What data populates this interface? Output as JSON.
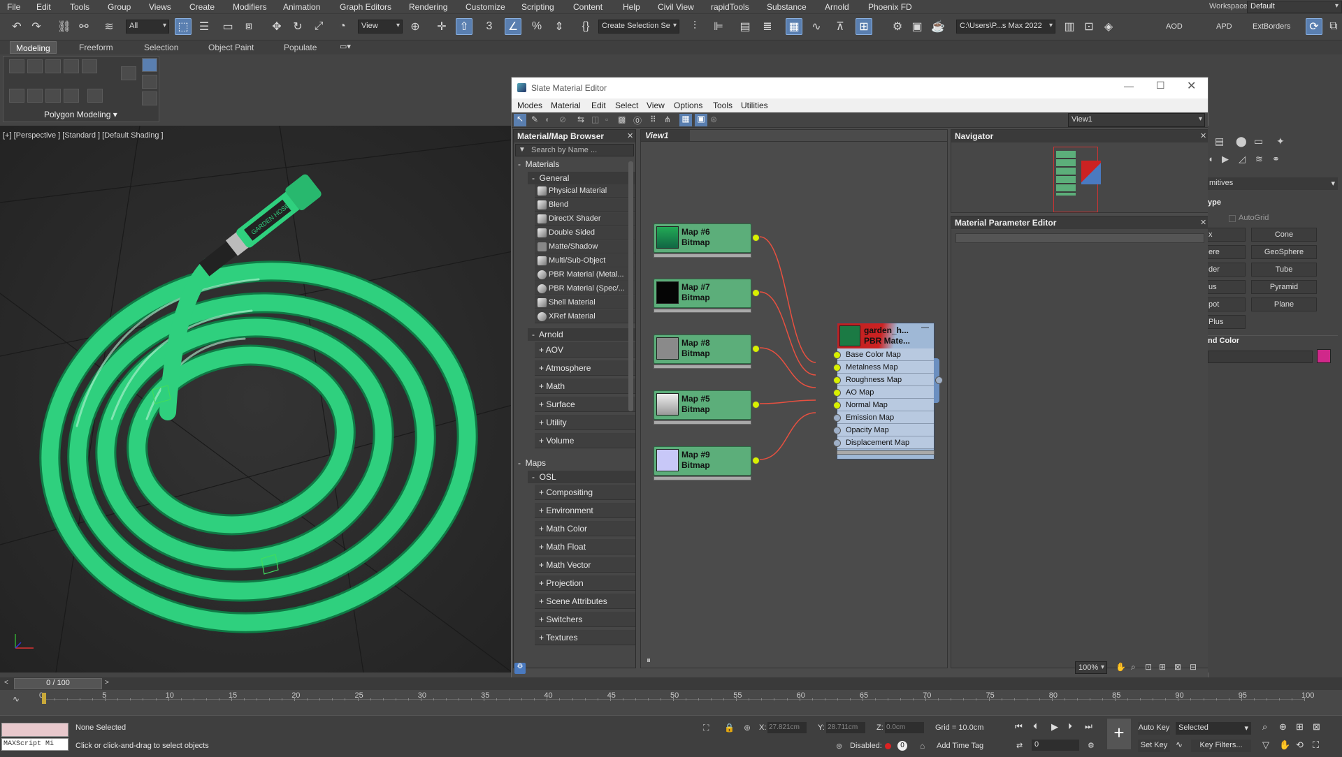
{
  "menubar": {
    "items": [
      "File",
      "Edit",
      "Tools",
      "Group",
      "Views",
      "Create",
      "Modifiers",
      "Animation",
      "Graph Editors",
      "Rendering",
      "Customize",
      "Scripting",
      "Content",
      "Help",
      "Civil View",
      "rapidTools",
      "Substance",
      "Arnold",
      "Phoenix FD"
    ],
    "workspaces_label": "Workspaces:",
    "workspace_value": "Default"
  },
  "toolbar": {
    "selection_filter": "All",
    "ref_coord": "View",
    "named_selection": "Create Selection Se",
    "project_path": "C:\\Users\\P...s Max 2022",
    "plugin_labels": [
      "AOD",
      "APD",
      "ExtBorders"
    ]
  },
  "ribbon": {
    "tabs": [
      "Modeling",
      "Freeform",
      "Selection",
      "Object Paint",
      "Populate"
    ],
    "active_tab": "Modeling",
    "panel_label": "Polygon Modeling"
  },
  "viewport": {
    "label": "[+] [Perspective ] [Standard ] [Default Shading ]",
    "hose_text": "GARDEN HOSE",
    "hose_color": "#2fd07e"
  },
  "slate": {
    "title": "Slate Material Editor",
    "menu": [
      "Modes",
      "Material",
      "Edit",
      "Select",
      "View",
      "Options",
      "Tools",
      "Utilities"
    ],
    "view_combo": "View1",
    "view_tab": "View1",
    "zoom": "100%",
    "browser": {
      "title": "Material/Map Browser",
      "search_placeholder": "Search by Name ...",
      "materials_label": "Materials",
      "general_label": "General",
      "general_items": [
        "Physical Material",
        "Blend",
        "DirectX Shader",
        "Double Sided",
        "Matte/Shadow",
        "Multi/Sub-Object",
        "PBR Material (Metal...",
        "PBR Material (Spec/...",
        "Shell Material",
        "XRef Material"
      ],
      "arnold_label": "Arnold",
      "arnold_items": [
        "+ AOV",
        "+ Atmosphere",
        "+ Math",
        "+ Surface",
        "+ Utility",
        "+ Volume"
      ],
      "maps_label": "Maps",
      "osl_label": "OSL",
      "osl_items": [
        "+ Compositing",
        "+ Environment",
        "+ Math Color",
        "+ Math Float",
        "+ Math Vector",
        "+ Projection",
        "+ Scene Attributes",
        "+ Switchers",
        "+ Textures"
      ]
    },
    "nodes": [
      {
        "name": "Map #6",
        "type": "Bitmap"
      },
      {
        "name": "Map #7",
        "type": "Bitmap"
      },
      {
        "name": "Map #8",
        "type": "Bitmap"
      },
      {
        "name": "Map #5",
        "type": "Bitmap"
      },
      {
        "name": "Map #9",
        "type": "Bitmap"
      }
    ],
    "pbr_node": {
      "name": "garden_h...",
      "type": "PBR Mate...",
      "slots": [
        "Base Color Map",
        "Metalness Map",
        "Roughness Map",
        "AO Map",
        "Normal Map",
        "Emission Map",
        "Opacity Map",
        "Displacement Map"
      ]
    },
    "navigator_title": "Navigator",
    "param_editor_title": "Material Parameter Editor"
  },
  "command_panel": {
    "rollout_primitives": "mitives",
    "rollout_type": "ype",
    "autogrid": "AutoGrid",
    "buttons": [
      "x",
      "Cone",
      "ere",
      "GeoSphere",
      "der",
      "Tube",
      "us",
      "Pyramid",
      "pot",
      "Plane",
      "Plus"
    ],
    "name_color": "nd Color",
    "swatch_color": "#d0288a"
  },
  "timeline": {
    "frame": "0 / 100",
    "ticks": [
      "0",
      "5",
      "10",
      "15",
      "20",
      "25",
      "30",
      "35",
      "40",
      "45",
      "50",
      "55",
      "60",
      "65",
      "70",
      "75",
      "80",
      "85",
      "90",
      "95",
      "100"
    ]
  },
  "status": {
    "maxscript": "MAXScript Mi",
    "selection": "None Selected",
    "prompt": "Click or click-and-drag to select objects",
    "x_label": "X:",
    "x_value": "27.821cm",
    "y_label": "Y:",
    "y_value": "28.711cm",
    "z_label": "Z:",
    "z_value": "0.0cm",
    "grid": "Grid = 10.0cm",
    "disabled": "Disabled:",
    "add_time_tag": "Add Time Tag",
    "auto_key": "Auto Key",
    "selected": "Selected",
    "set_key": "Set Key",
    "key_filters": "Key Filters...",
    "current_frame": "0"
  }
}
